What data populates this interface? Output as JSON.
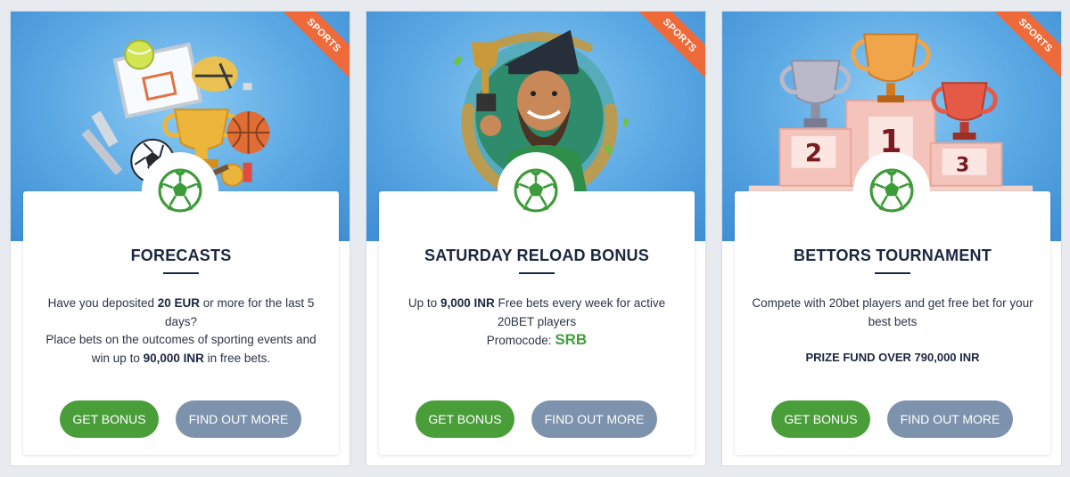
{
  "cards": [
    {
      "ribbon": "SPORTS",
      "title": "FORECASTS",
      "desc": {
        "t1": "Have you deposited ",
        "b1": "20 EUR",
        "t2": " or more for the last 5 days?",
        "t3": "Place bets on the outcomes of sporting events and win up to ",
        "b2": "90,000 INR",
        "t4": " in free bets."
      },
      "primary_label": "GET BONUS",
      "secondary_label": "FIND OUT MORE"
    },
    {
      "ribbon": "SPORTS",
      "title": "SATURDAY RELOAD BONUS",
      "desc": {
        "t1": "Up to ",
        "b1": "9,000 INR",
        "t2": " Free bets every week for active 20BET players",
        "promo_label": "Promocode: ",
        "promo_code": "SRB"
      },
      "primary_label": "GET BONUS",
      "secondary_label": "FIND OUT MORE"
    },
    {
      "ribbon": "SPORTS",
      "title": "BETTORS TOURNAMENT",
      "desc": {
        "t1": "Compete with 20bet players and get free bet for your best bets",
        "prize": "PRIZE FUND OVER 790,000 INR"
      },
      "primary_label": "GET BONUS",
      "secondary_label": "FIND OUT MORE"
    }
  ],
  "podium": {
    "first": "1",
    "second": "2",
    "third": "3"
  },
  "colors": {
    "accent_green": "#4a9e39",
    "button_grey": "#7d92ad",
    "ribbon_orange": "#ee6a3a",
    "title_navy": "#1b2640",
    "promo_green": "#3ea03a"
  },
  "icons": {
    "badge": "soccer-ball-icon",
    "art1": "sports-equipment-illustration",
    "art2": "pirate-with-trophy-illustration",
    "art3": "trophy-podium-illustration"
  }
}
